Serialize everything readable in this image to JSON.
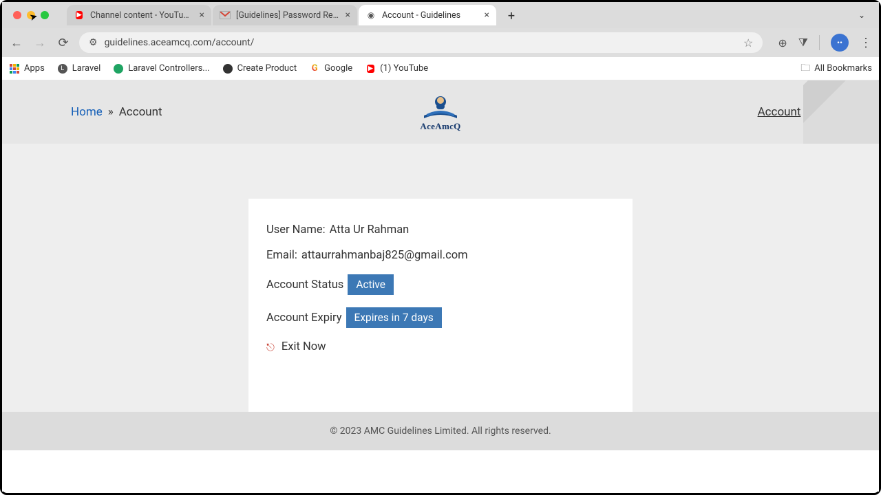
{
  "os": {
    "tabs": [
      {
        "label": "Channel content - YouTube St",
        "favicon": "youtube"
      },
      {
        "label": "[Guidelines] Password Reset",
        "favicon": "gmail"
      },
      {
        "label": "Account - Guidelines",
        "favicon": "globe",
        "active": true
      }
    ],
    "url": "guidelines.aceamcq.com/account/"
  },
  "bookmarks": {
    "items": [
      {
        "label": "Apps",
        "icon": "apps"
      },
      {
        "label": "Laravel",
        "icon": "laravel"
      },
      {
        "label": "Laravel Controllers...",
        "icon": "green"
      },
      {
        "label": "Create Product",
        "icon": "dark"
      },
      {
        "label": "Google",
        "icon": "google"
      },
      {
        "label": "(1) YouTube",
        "icon": "youtube"
      }
    ],
    "all_label": "All Bookmarks"
  },
  "header": {
    "breadcrumb_home": "Home",
    "breadcrumb_sep": "»",
    "breadcrumb_current": "Account",
    "brand": "AceAmcQ",
    "account_menu": "Account"
  },
  "card": {
    "username_label": "User Name:",
    "username_value": "Atta Ur Rahman",
    "email_label": "Email:",
    "email_value": "attaurrahmanbaj825@gmail.com",
    "status_label": "Account Status",
    "status_badge": "Active",
    "expiry_label": "Account Expiry",
    "expiry_badge": "Expires in 7 days",
    "exit_label": "Exit Now"
  },
  "footer": {
    "text": "© 2023 AMC Guidelines Limited. All rights reserved."
  }
}
